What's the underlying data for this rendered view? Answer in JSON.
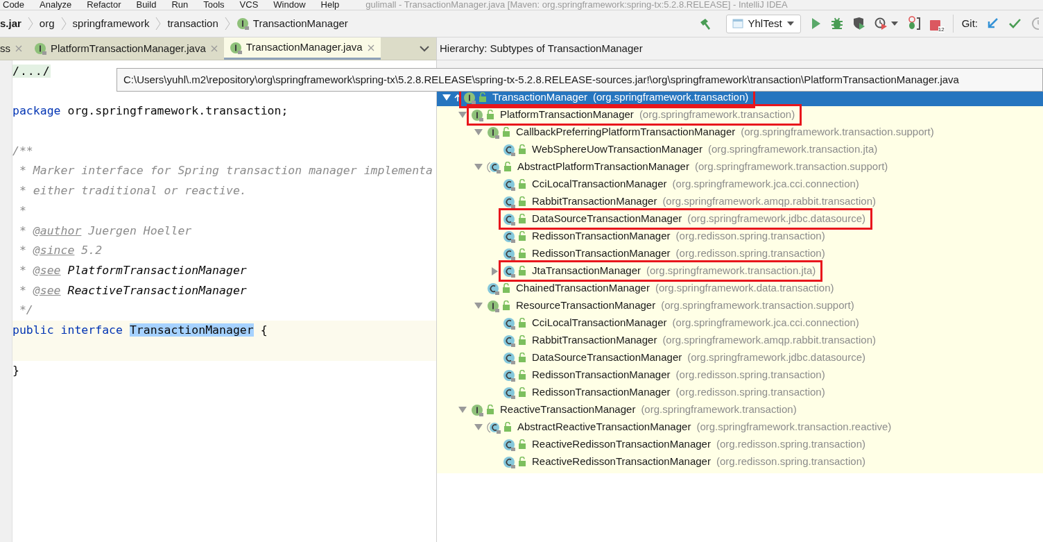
{
  "menu": [
    "Code",
    "Analyze",
    "Refactor",
    "Build",
    "Run",
    "Tools",
    "VCS",
    "Window",
    "Help"
  ],
  "window": {
    "title": "gulimall - TransactionManager.java [Maven: org.springframework:spring-tx:5.2.8.RELEASE] - IntelliJ IDEA"
  },
  "breadcrumb": [
    {
      "label": "s.jar",
      "kind": "jar"
    },
    {
      "label": "org",
      "kind": "package"
    },
    {
      "label": "springframework",
      "kind": "package"
    },
    {
      "label": "transaction",
      "kind": "package"
    },
    {
      "label": "TransactionManager",
      "kind": "interface"
    }
  ],
  "toolbar": {
    "run_config": "YhlTest",
    "stop_badge": "12",
    "git_label": "Git:"
  },
  "tabs": [
    {
      "label": "ss",
      "kind": "cut",
      "selected": false
    },
    {
      "label": "PlatformTransactionManager.java",
      "kind": "interface",
      "selected": false
    },
    {
      "label": "TransactionManager.java",
      "kind": "interface",
      "selected": true
    }
  ],
  "editor": {
    "lines": [
      {
        "caret": false,
        "blank_after": true,
        "tokens": [
          {
            "kind": "folded",
            "text": "/.../"
          }
        ]
      },
      {
        "caret": false,
        "blank_after": true,
        "tokens": [
          {
            "kind": "keyword",
            "text": "package"
          },
          {
            "kind": "plain",
            "text": " org.springframework.transaction;"
          }
        ]
      },
      {
        "caret": false,
        "tokens": [
          {
            "kind": "comment",
            "text": "/**"
          }
        ]
      },
      {
        "caret": false,
        "tokens": [
          {
            "kind": "comment",
            "text": " * Marker interface for Spring transaction manager implementa"
          }
        ]
      },
      {
        "caret": false,
        "tokens": [
          {
            "kind": "comment",
            "text": " * either traditional or reactive."
          }
        ]
      },
      {
        "caret": false,
        "tokens": [
          {
            "kind": "comment",
            "text": " *"
          }
        ]
      },
      {
        "caret": false,
        "tokens": [
          {
            "kind": "comment",
            "text": " * "
          },
          {
            "kind": "tag",
            "text": "@author"
          },
          {
            "kind": "comment",
            "text": " Juergen Hoeller"
          }
        ]
      },
      {
        "caret": false,
        "tokens": [
          {
            "kind": "comment",
            "text": " * "
          },
          {
            "kind": "tag",
            "text": "@since"
          },
          {
            "kind": "comment",
            "text": " 5.2"
          }
        ]
      },
      {
        "caret": false,
        "tokens": [
          {
            "kind": "comment",
            "text": " * "
          },
          {
            "kind": "tag",
            "text": "@see"
          },
          {
            "kind": "ref",
            "text": " PlatformTransactionManager"
          }
        ]
      },
      {
        "caret": false,
        "tokens": [
          {
            "kind": "comment",
            "text": " * "
          },
          {
            "kind": "tag",
            "text": "@see"
          },
          {
            "kind": "ref",
            "text": " ReactiveTransactionManager"
          }
        ]
      },
      {
        "caret": false,
        "tokens": [
          {
            "kind": "comment",
            "text": " */"
          }
        ]
      },
      {
        "caret": true,
        "blank_after": true,
        "tokens": [
          {
            "kind": "keyword",
            "text": "public interface "
          },
          {
            "kind": "selection",
            "text": "TransactionManager"
          },
          {
            "kind": "plain",
            "text": " {"
          }
        ]
      },
      {
        "caret": false,
        "tokens": [
          {
            "kind": "plain",
            "text": "}"
          }
        ]
      }
    ]
  },
  "tooltip": "C:\\Users\\yuhl\\.m2\\repository\\org\\springframework\\spring-tx\\5.2.8.RELEASE\\spring-tx-5.2.8.RELEASE-sources.jar!\\org\\springframework\\transaction\\PlatformTransactionManager.java",
  "hierarchy": {
    "title": "Hierarchy:  Subtypes of TransactionManager",
    "tree": [
      {
        "name": "TransactionManager",
        "package": "(org.springframework.transaction)",
        "kind": "interface",
        "selected": true,
        "highlighted": true,
        "expanded": true,
        "children": [
          {
            "name": "PlatformTransactionManager",
            "package": "(org.springframework.transaction)",
            "kind": "interface",
            "selected": false,
            "highlighted": true,
            "expanded": true,
            "children": [
              {
                "name": "CallbackPreferringPlatformTransactionManager",
                "package": "(org.springframework.transaction.support)",
                "kind": "interface",
                "selected": false,
                "highlighted": false,
                "expanded": true,
                "children": [
                  {
                    "name": "WebSphereUowTransactionManager",
                    "package": "(org.springframework.transaction.jta)",
                    "kind": "class",
                    "selected": false,
                    "highlighted": false
                  }
                ]
              },
              {
                "name": "AbstractPlatformTransactionManager",
                "package": "(org.springframework.transaction.support)",
                "kind": "abstract",
                "selected": false,
                "highlighted": false,
                "expanded": true,
                "children": [
                  {
                    "name": "CciLocalTransactionManager",
                    "package": "(org.springframework.jca.cci.connection)",
                    "kind": "class",
                    "selected": false,
                    "highlighted": false
                  },
                  {
                    "name": "RabbitTransactionManager",
                    "package": "(org.springframework.amqp.rabbit.transaction)",
                    "kind": "class",
                    "selected": false,
                    "highlighted": false
                  },
                  {
                    "name": "DataSourceTransactionManager",
                    "package": "(org.springframework.jdbc.datasource)",
                    "kind": "class",
                    "selected": false,
                    "highlighted": true
                  },
                  {
                    "name": "RedissonTransactionManager",
                    "package": "(org.redisson.spring.transaction)",
                    "kind": "class",
                    "selected": false,
                    "highlighted": false
                  },
                  {
                    "name": "RedissonTransactionManager",
                    "package": "(org.redisson.spring.transaction)",
                    "kind": "class",
                    "selected": false,
                    "highlighted": false
                  },
                  {
                    "name": "JtaTransactionManager",
                    "package": "(org.springframework.transaction.jta)",
                    "kind": "class",
                    "selected": false,
                    "highlighted": true,
                    "expanded": false
                  }
                ]
              },
              {
                "name": "ChainedTransactionManager",
                "package": "(org.springframework.data.transaction)",
                "kind": "class",
                "selected": false,
                "highlighted": false
              },
              {
                "name": "ResourceTransactionManager",
                "package": "(org.springframework.transaction.support)",
                "kind": "interface",
                "selected": false,
                "highlighted": false,
                "expanded": true,
                "children": [
                  {
                    "name": "CciLocalTransactionManager",
                    "package": "(org.springframework.jca.cci.connection)",
                    "kind": "class",
                    "selected": false,
                    "highlighted": false
                  },
                  {
                    "name": "RabbitTransactionManager",
                    "package": "(org.springframework.amqp.rabbit.transaction)",
                    "kind": "class",
                    "selected": false,
                    "highlighted": false
                  },
                  {
                    "name": "DataSourceTransactionManager",
                    "package": "(org.springframework.jdbc.datasource)",
                    "kind": "class",
                    "selected": false,
                    "highlighted": false
                  },
                  {
                    "name": "RedissonTransactionManager",
                    "package": "(org.redisson.spring.transaction)",
                    "kind": "class",
                    "selected": false,
                    "highlighted": false
                  },
                  {
                    "name": "RedissonTransactionManager",
                    "package": "(org.redisson.spring.transaction)",
                    "kind": "class",
                    "selected": false,
                    "highlighted": false
                  }
                ]
              }
            ]
          },
          {
            "name": "ReactiveTransactionManager",
            "package": "(org.springframework.transaction)",
            "kind": "interface",
            "selected": false,
            "highlighted": false,
            "expanded": true,
            "children": [
              {
                "name": "AbstractReactiveTransactionManager",
                "package": "(org.springframework.transaction.reactive)",
                "kind": "abstract",
                "selected": false,
                "highlighted": false,
                "expanded": true,
                "children": [
                  {
                    "name": "ReactiveRedissonTransactionManager",
                    "package": "(org.redisson.spring.transaction)",
                    "kind": "class",
                    "selected": false,
                    "highlighted": false
                  },
                  {
                    "name": "ReactiveRedissonTransactionManager",
                    "package": "(org.redisson.spring.transaction)",
                    "kind": "class",
                    "selected": false,
                    "highlighted": false
                  }
                ]
              }
            ]
          }
        ]
      }
    ]
  }
}
